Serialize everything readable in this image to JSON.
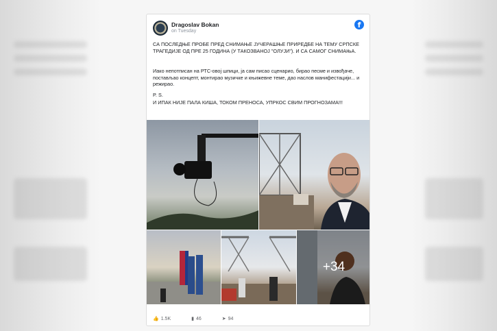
{
  "post": {
    "author": "Dragoslav Bokan",
    "time": "on Tuesday",
    "text_main": "СА ПОСЛЕДЊЕ ПРОБЕ ПРЕД СНИМАЊЕ ЈУЧЕРАШЊЕ ПРИРЕДБЕ НА ТЕМУ СРПСКЕ ТРАГЕДИЈЕ ОД ПРЕ 25 ГОДИНА (У ТАКОЗВАНОЈ \"ОЛУЈИ\"). И СА САМОГ СНИМАЊА.",
    "text_body": "Иако непотписан на РТС-овој шпици, ја сам писао сценарио, бирао песме и извођаче, постављао концепт, монтирао музичке и књижевне теме, дао наслов манифестацији... и режирао.",
    "ps_label": "P. S.",
    "ps_text": "И ИПАК НИЈЕ ПАЛА КИША, ТОКОМ ПРЕНОСА, УПРКОС СВИМ ПРОГНОЗАМА!!!",
    "more_photos": "+34"
  },
  "stats": {
    "reactions": "1.5K",
    "comments": "46",
    "shares": "94"
  },
  "icons": {
    "brand": "facebook-icon",
    "like": "thumbs-up-icon",
    "comment": "comment-icon",
    "share": "share-icon"
  },
  "colors": {
    "facebook_blue": "#1877f2"
  }
}
